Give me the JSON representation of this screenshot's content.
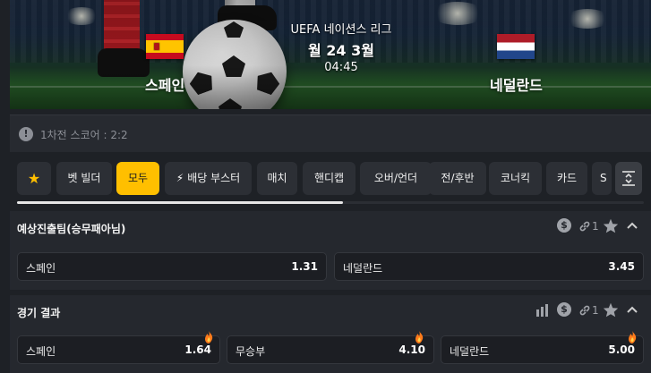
{
  "header": {
    "league": "UEFA 네이션스 리그",
    "date": "월 24 3월",
    "time": "04:45",
    "home_team": "스페인",
    "away_team": "네덜란드"
  },
  "info": {
    "icon": "info-icon",
    "text": "1차전 스코어 : 2:2"
  },
  "tabs": [
    {
      "label": "★",
      "icon": "star-icon"
    },
    {
      "label": "벳 빌더"
    },
    {
      "label": "모두",
      "active": true
    },
    {
      "label": "배당 부스터",
      "icon": "bolt-icon"
    },
    {
      "label": "매치"
    },
    {
      "label": "핸디캡"
    },
    {
      "label": "오버/언더"
    },
    {
      "label": "전/후반"
    },
    {
      "label": "코너킥"
    },
    {
      "label": "카드"
    },
    {
      "label": "S"
    }
  ],
  "markets": [
    {
      "title": "예상진출팀(승무패아님)",
      "link_count": "1",
      "outcomes": [
        {
          "label": "스페인",
          "odds": "1.31"
        },
        {
          "label": "네덜란드",
          "odds": "3.45"
        }
      ]
    },
    {
      "title": "경기 결과",
      "link_count": "1",
      "outcomes": [
        {
          "label": "스페인",
          "odds": "1.64",
          "boosted": true
        },
        {
          "label": "무승부",
          "odds": "4.10",
          "boosted": true
        },
        {
          "label": "네덜란드",
          "odds": "5.00",
          "boosted": true
        }
      ]
    }
  ],
  "colors": {
    "accent": "#ffbf00",
    "background": "#1e2126",
    "panel": "#25282e"
  }
}
